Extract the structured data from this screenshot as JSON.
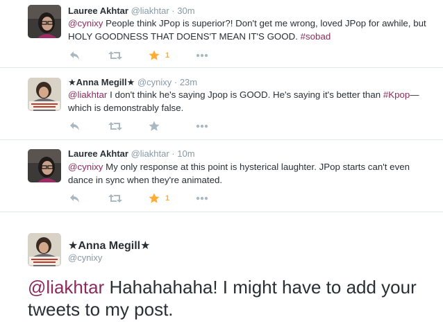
{
  "tweets": [
    {
      "name": "Lauree Akhtar",
      "handle": "@liakhtar",
      "dot": "·",
      "time": "30m",
      "mention": "@cynixy",
      "text": " People think JPop is superior?! Don't get me wrong, loved JPop for awhile, but HOLY GOODNESS THAT DOENS'T MEAN IT'S GOOD. ",
      "hashtag": "#sobad",
      "favorited": true,
      "fav_count": "1",
      "avatar_icon": "profile-photo-woman-glasses"
    },
    {
      "name": "★Anna Megill★",
      "handle": "@cynixy",
      "dot": "·",
      "time": "23m",
      "mention": "@liakhtar",
      "text_1": " I don't think he's saying Jpop is GOOD. He's saying it's better than ",
      "hashtag": "#Kpop",
      "text_2": "—which is demonstrably false.",
      "favorited": false,
      "fav_count": "",
      "avatar_icon": "profile-photo-woman-sign"
    },
    {
      "name": "Lauree Akhtar",
      "handle": "@liakhtar",
      "dot": "·",
      "time": "10m",
      "mention": "@cynixy",
      "text": " My only response at this point is hysterical laughter. JPop starts can't even dance in sync when they're animated.",
      "favorited": true,
      "fav_count": "1",
      "avatar_icon": "profile-photo-woman-glasses"
    }
  ],
  "focused_tweet": {
    "name": "★Anna Megill★",
    "handle": "@cynixy",
    "mention": "@liakhtar",
    "text": " Hahahahaha! I might have to add your tweets to my post.",
    "avatar_icon": "profile-photo-woman-sign"
  },
  "colors": {
    "link": "#8b2b5d",
    "fav_active": "#ffac33",
    "icon_gray": "#aab8c2",
    "meta_gray": "#8899a6"
  },
  "icons": [
    "reply-icon",
    "retweet-icon",
    "favorite-icon",
    "more-icon"
  ]
}
